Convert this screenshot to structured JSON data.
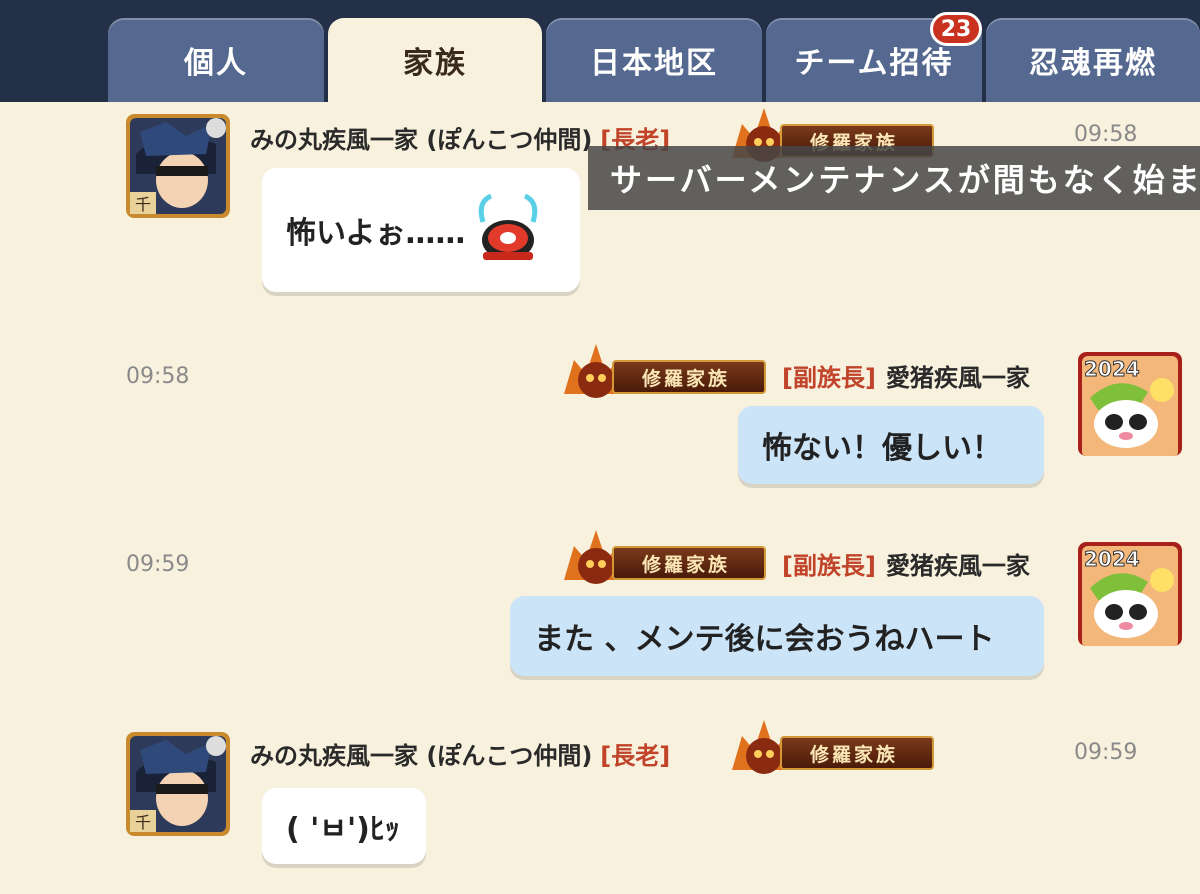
{
  "tabs": [
    {
      "label": "個人",
      "active": false
    },
    {
      "label": "家族",
      "active": true
    },
    {
      "label": "日本地区",
      "active": false
    },
    {
      "label": "チーム招待",
      "active": false,
      "badge": "23"
    },
    {
      "label": "忍魂再燃",
      "active": false
    }
  ],
  "ticker": {
    "text": "サーバーメンテナンスが間もなく始ま"
  },
  "clan_badge_text": "修羅家族",
  "messages": [
    {
      "sender": "みの丸疾風一家 (ぽんこつ仲間)",
      "role": "[長老]",
      "time": "09:58",
      "text": "怖いよぉ……",
      "side": "left",
      "avatar": "ninja-avatar",
      "sticker": "crying-eye-sticker"
    },
    {
      "sender": "愛猪疾風一家",
      "role": "[副族長]",
      "time": "09:58",
      "text": "怖ない！優しい！",
      "side": "right",
      "avatar": "panda-avatar"
    },
    {
      "sender": "愛猪疾風一家",
      "role": "[副族長]",
      "time": "09:59",
      "text": "また 、メンテ後に会おうねハート",
      "side": "right",
      "avatar": "panda-avatar"
    },
    {
      "sender": "みの丸疾風一家 (ぽんこつ仲間)",
      "role": "[長老]",
      "time": "09:59",
      "text": "( 'ㅂ')ﾋｯ",
      "side": "left",
      "avatar": "ninja-avatar"
    }
  ],
  "avatar_labels": {
    "ninja_rank": "千",
    "panda_year": "2024"
  },
  "colors": {
    "tab_bg": "#55688f",
    "tab_active_bg": "#f7f1de",
    "header_bg": "#243048",
    "chat_bg": "#f7f1de",
    "role_color": "#c0432a",
    "right_bubble": "#cce4f7"
  }
}
